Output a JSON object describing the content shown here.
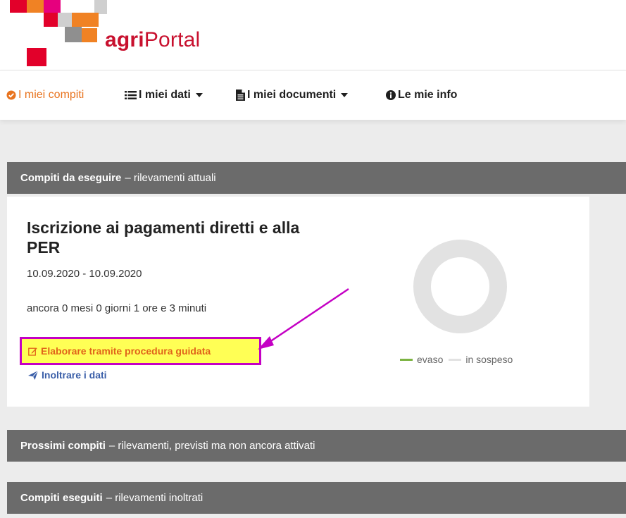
{
  "header": {
    "brand_bold": "agri",
    "brand_rest": "Portal"
  },
  "nav": {
    "items": [
      {
        "label": "I miei compiti",
        "icon": "check-circle-icon",
        "active": true
      },
      {
        "label": "I miei dati",
        "icon": "list-icon",
        "dropdown": true
      },
      {
        "label": "I miei documenti",
        "icon": "document-icon",
        "dropdown": true
      },
      {
        "label": "Le mie info",
        "icon": "info-circle-icon"
      }
    ]
  },
  "sections": {
    "current": {
      "title": "Compiti da eseguire",
      "subtitle": "– rilevamenti attuali"
    },
    "upcoming": {
      "title": "Prossimi compiti",
      "subtitle": "– rilevamenti, previsti ma non ancora attivati"
    },
    "done": {
      "title": "Compiti eseguiti",
      "subtitle": "– rilevamenti inoltrati"
    }
  },
  "task": {
    "title": "Iscrizione ai pagamenti diretti e alla PER",
    "dates": "10.09.2020 - 10.09.2020",
    "remaining": "ancora 0 mesi 0 giorni 1 ore e 3 minuti",
    "wizard_button": "Elaborare tramite procedura guidata",
    "send_button": "Inoltrare i dati"
  },
  "chart_data": {
    "type": "pie",
    "variant": "donut",
    "categories": [
      "evaso",
      "in sospeso"
    ],
    "values": [
      0,
      1
    ],
    "colors": [
      "#7cb342",
      "#e2e2e2"
    ],
    "legend_position": "bottom"
  },
  "colors": {
    "accent": "#e8731e",
    "brand": "#c8102e",
    "section_bar": "#6b6b6b",
    "highlight": "#ffff55",
    "annotation": "#c400c4",
    "link": "#3a5ea8"
  }
}
